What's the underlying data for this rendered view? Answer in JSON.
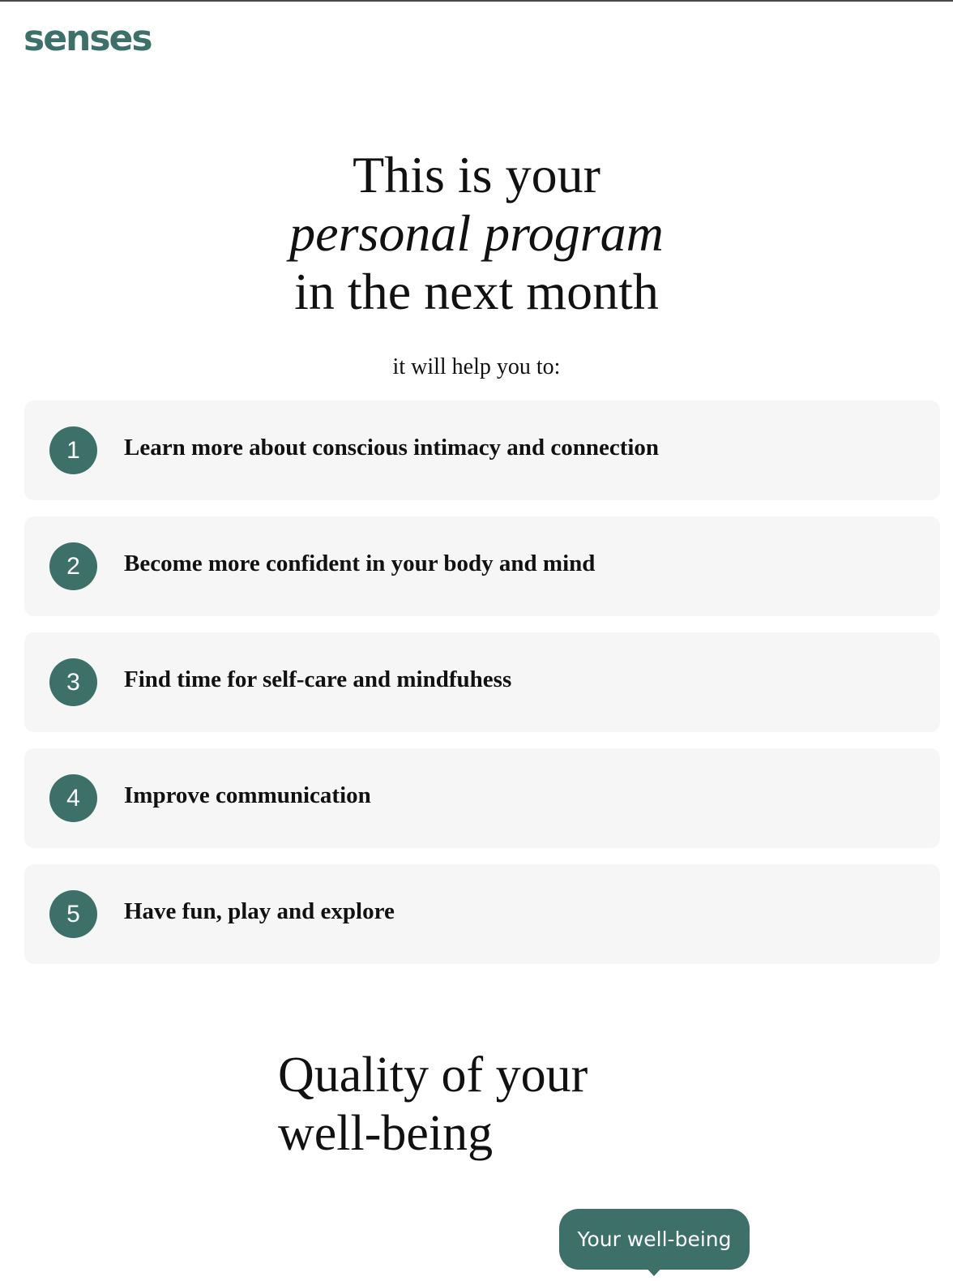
{
  "brand": {
    "logo_text": "senses",
    "accent_color": "#3d7068"
  },
  "hero": {
    "title_line1": "This is your",
    "title_line2": "personal program",
    "title_line3": "in the next month",
    "subtitle": "it will help you to:"
  },
  "goals": [
    {
      "number": "1",
      "text": "Learn more about conscious intimacy and connection"
    },
    {
      "number": "2",
      "text": "Become more confident in your body and mind"
    },
    {
      "number": "3",
      "text": "Find time for self-care and mindfuhess"
    },
    {
      "number": "4",
      "text": "Improve communication"
    },
    {
      "number": "5",
      "text": "Have fun, play and explore"
    }
  ],
  "wellbeing": {
    "title_line1": "Quality of your",
    "title_line2": "well-being",
    "tooltip_label": "Your well-being"
  }
}
